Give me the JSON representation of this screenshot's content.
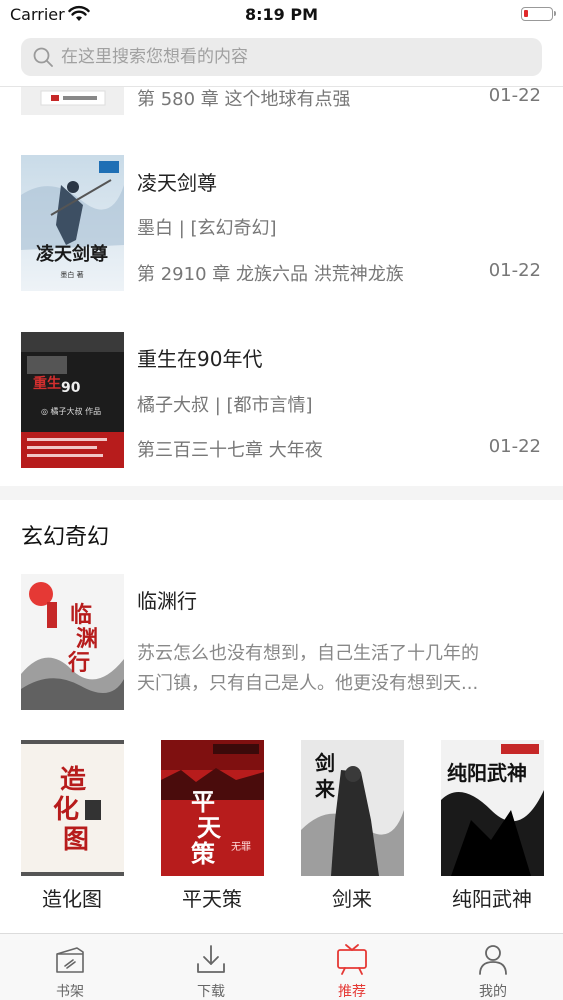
{
  "status_bar": {
    "carrier": "Carrier",
    "time": "8:19 PM"
  },
  "search": {
    "placeholder": "在这里搜索您想看的内容"
  },
  "updates": [
    {
      "chapter": "第 580 章 这个地球有点强",
      "date": "01-22"
    },
    {
      "title": "凌天剑尊",
      "meta": "墨白 | [玄幻奇幻]",
      "chapter": "第 2910 章 龙族六品 洪荒神龙族",
      "date": "01-22"
    },
    {
      "title": "重生在90年代",
      "meta": "橘子大叔 | [都市言情]",
      "chapter": "第三百三十七章 大年夜",
      "date": "01-22"
    }
  ],
  "section": {
    "title": "玄幻奇幻",
    "featured": {
      "title": "临渊行",
      "desc_line1": "苏云怎么也没有想到，自己生活了十几年的",
      "desc_line2": "天门镇，只有自己是人。他更没有想到天..."
    },
    "grid": [
      {
        "title": "造化图"
      },
      {
        "title": "平天策"
      },
      {
        "title": "剑来"
      },
      {
        "title": "纯阳武神"
      }
    ]
  },
  "tabs": [
    {
      "label": "书架",
      "icon": "bookshelf-icon"
    },
    {
      "label": "下载",
      "icon": "download-icon"
    },
    {
      "label": "推荐",
      "icon": "recommend-icon",
      "active": true
    },
    {
      "label": "我的",
      "icon": "profile-icon"
    }
  ],
  "colors": {
    "accent": "#e53935",
    "search_bg": "#ebebeb",
    "tab_bg": "#f8f8f8"
  }
}
